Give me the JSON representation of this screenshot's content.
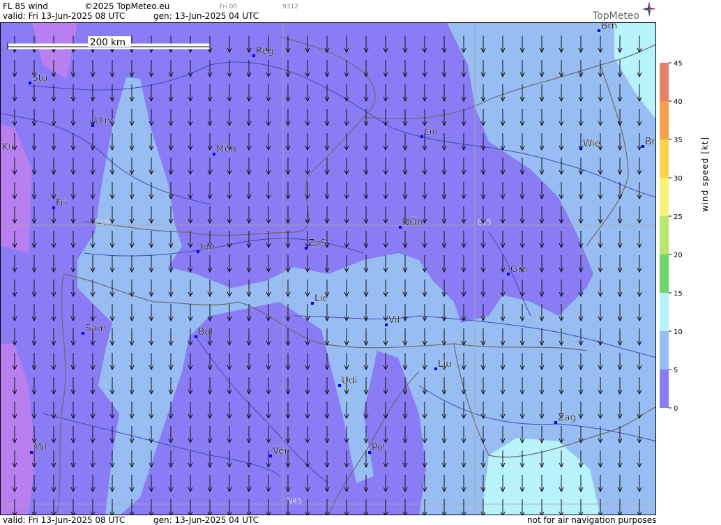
{
  "header": {
    "product": "FL 85 wind",
    "copyright": "©2025 TopMeteo.eu",
    "frame_label": "Fri 00",
    "frame_id": "9312",
    "valid": "valid:  Fri  13-Jun-2025  08 UTC",
    "generated": "gen: 13-Jun-2025 04 UTC"
  },
  "logo": {
    "text": "TopMeteo",
    "icon": "compass-star-icon"
  },
  "map": {
    "scale_bar_label": "200 km",
    "grid_labels": {
      "lon_west": "E10",
      "lon_east": "E15",
      "lat_south": "N45"
    },
    "cities": [
      {
        "name": "Brn"
      },
      {
        "name": "Reg"
      },
      {
        "name": "Stu"
      },
      {
        "name": "Ulm"
      },
      {
        "name": "Kli"
      },
      {
        "name": "Mün"
      },
      {
        "name": "Lin"
      },
      {
        "name": "Wie"
      },
      {
        "name": "Br"
      },
      {
        "name": "Fri"
      },
      {
        "name": "NÖb"
      },
      {
        "name": "Inn"
      },
      {
        "name": "ZaS"
      },
      {
        "name": "Gra"
      },
      {
        "name": "Lie"
      },
      {
        "name": "Vil"
      },
      {
        "name": "Sam"
      },
      {
        "name": "Bol"
      },
      {
        "name": "Lju"
      },
      {
        "name": "Udi"
      },
      {
        "name": "Zag"
      },
      {
        "name": "Mil"
      },
      {
        "name": "Ven"
      },
      {
        "name": "Pot"
      }
    ],
    "wind_direction": "north-to-south",
    "colors": {
      "band_0_5": "#b87ff0",
      "band_5_10": "#8a7cf4",
      "band_10_15": "#97bdf2",
      "band_15_20": "#b8f2fb",
      "border": "#6b6b6b",
      "river": "#3f4bb5",
      "city_marker": "#0000ff"
    }
  },
  "legend": {
    "title": "wind  speed  [kt]",
    "ticks": [
      "45",
      "40",
      "35",
      "30",
      "25",
      "20",
      "15",
      "10",
      "5",
      "0"
    ],
    "colors": [
      "#e9806a",
      "#f3a14e",
      "#fbd24c",
      "#f7f27a",
      "#b8e66e",
      "#6fd66f",
      "#b8f2fb",
      "#97bdf2",
      "#8a7cf4",
      "#b87ff0"
    ]
  },
  "footer": {
    "valid": "valid:  Fri  13-Jun-2025  08 UTC",
    "generated": "gen: 13-Jun-2025 04 UTC",
    "disclaimer": "not for air navigation purposes"
  }
}
